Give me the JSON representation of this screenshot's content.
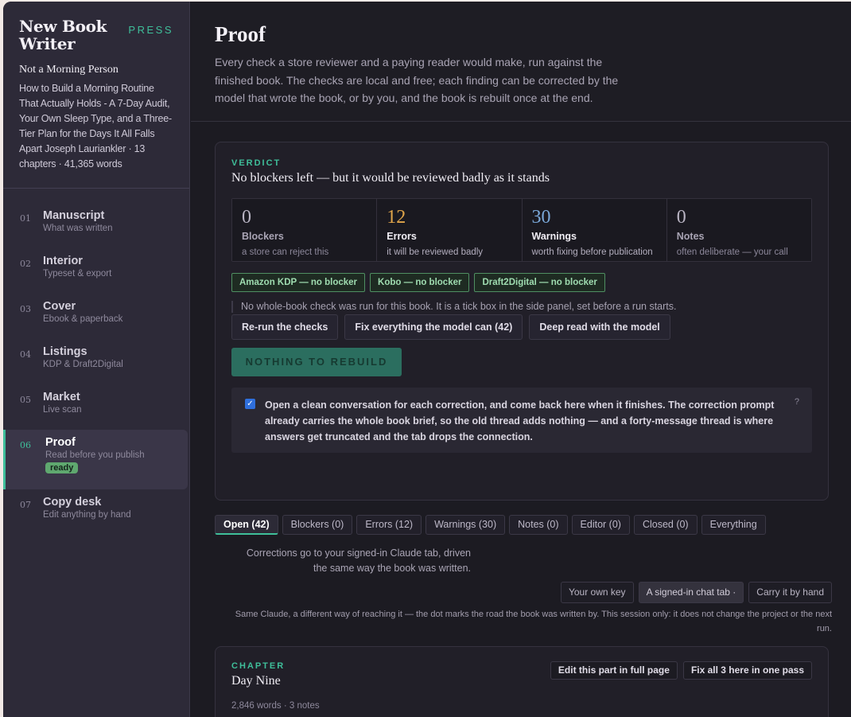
{
  "sidebar": {
    "app_title": "New Book Writer",
    "press_label": "PRESS",
    "book_title": "Not a Morning Person",
    "book_description": "How to Build a Morning Routine That Actually Holds - A 7-Day Audit, Your Own Sleep Type, and a Three-Tier Plan for the Days It All Falls Apart Joseph Lauriankler · 13 chapters · 41,365 words",
    "items": [
      {
        "num": "01",
        "label": "Manuscript",
        "sub": "What was written"
      },
      {
        "num": "02",
        "label": "Interior",
        "sub": "Typeset & export"
      },
      {
        "num": "03",
        "label": "Cover",
        "sub": "Ebook & paperback"
      },
      {
        "num": "04",
        "label": "Listings",
        "sub": "KDP & Draft2Digital"
      },
      {
        "num": "05",
        "label": "Market",
        "sub": "Live scan"
      },
      {
        "num": "06",
        "label": "Proof",
        "sub": "Read before you publish",
        "badge": "ready"
      },
      {
        "num": "07",
        "label": "Copy desk",
        "sub": "Edit anything by hand"
      }
    ]
  },
  "header": {
    "title": "Proof",
    "intro": "Every check a store reviewer and a paying reader would make, run against the finished book. The checks are local and free; each finding can be corrected by the model that wrote the book, or by you, and the book is rebuilt once at the end."
  },
  "verdict": {
    "eyebrow": "VERDICT",
    "text": "No blockers left — but it would be reviewed badly as it stands",
    "stats": [
      {
        "value": "0",
        "label": "Blockers",
        "desc": "a store can reject this",
        "color": "#b9b4c3"
      },
      {
        "value": "12",
        "label": "Errors",
        "desc": "it will be reviewed badly",
        "color": "#e0a54a"
      },
      {
        "value": "30",
        "label": "Warnings",
        "desc": "worth fixing before publication",
        "color": "#7aa8d9"
      },
      {
        "value": "0",
        "label": "Notes",
        "desc": "often deliberate — your call",
        "color": "#b9b4c3"
      }
    ],
    "stores": [
      "Amazon KDP — no blocker",
      "Kobo — no blocker",
      "Draft2Digital — no blocker"
    ],
    "whole_book_note": "No whole-book check was run for this book. It is a tick box in the side panel, set before a run starts.",
    "actions": {
      "rerun": "Re-run the checks",
      "fix_all": "Fix everything the model can (42)",
      "deep_read": "Deep read with the model"
    },
    "rebuild_label": "NOTHING TO REBUILD",
    "clean_conversation": {
      "checked": true,
      "text": "Open a clean conversation for each correction, and come back here when it finishes. The correction prompt already carries the whole book brief, so the old thread adds nothing — and a forty-message thread is where answers get truncated and the tab drops the connection.",
      "help": "?"
    }
  },
  "filters": {
    "tabs": [
      "Open (42)",
      "Blockers (0)",
      "Errors (12)",
      "Warnings (30)",
      "Notes (0)",
      "Editor (0)",
      "Closed (0)",
      "Everything"
    ],
    "active": "Open (42)"
  },
  "routing": {
    "note": "Corrections go to your signed-in Claude tab, driven the same way the book was written.",
    "options": [
      "Your own key",
      "A signed-in chat tab ·",
      "Carry it by hand"
    ],
    "selected": "A signed-in chat tab ·",
    "fine_print": "Same Claude, a different way of reaching it — the dot marks the road the book was written by. This session only: it does not change the project or the next run."
  },
  "chapter": {
    "eyebrow": "CHAPTER",
    "name": "Day Nine",
    "meta": "2,846 words · 3 notes",
    "edit_label": "Edit this part in full page",
    "fix_label": "Fix all 3 here in one pass"
  }
}
